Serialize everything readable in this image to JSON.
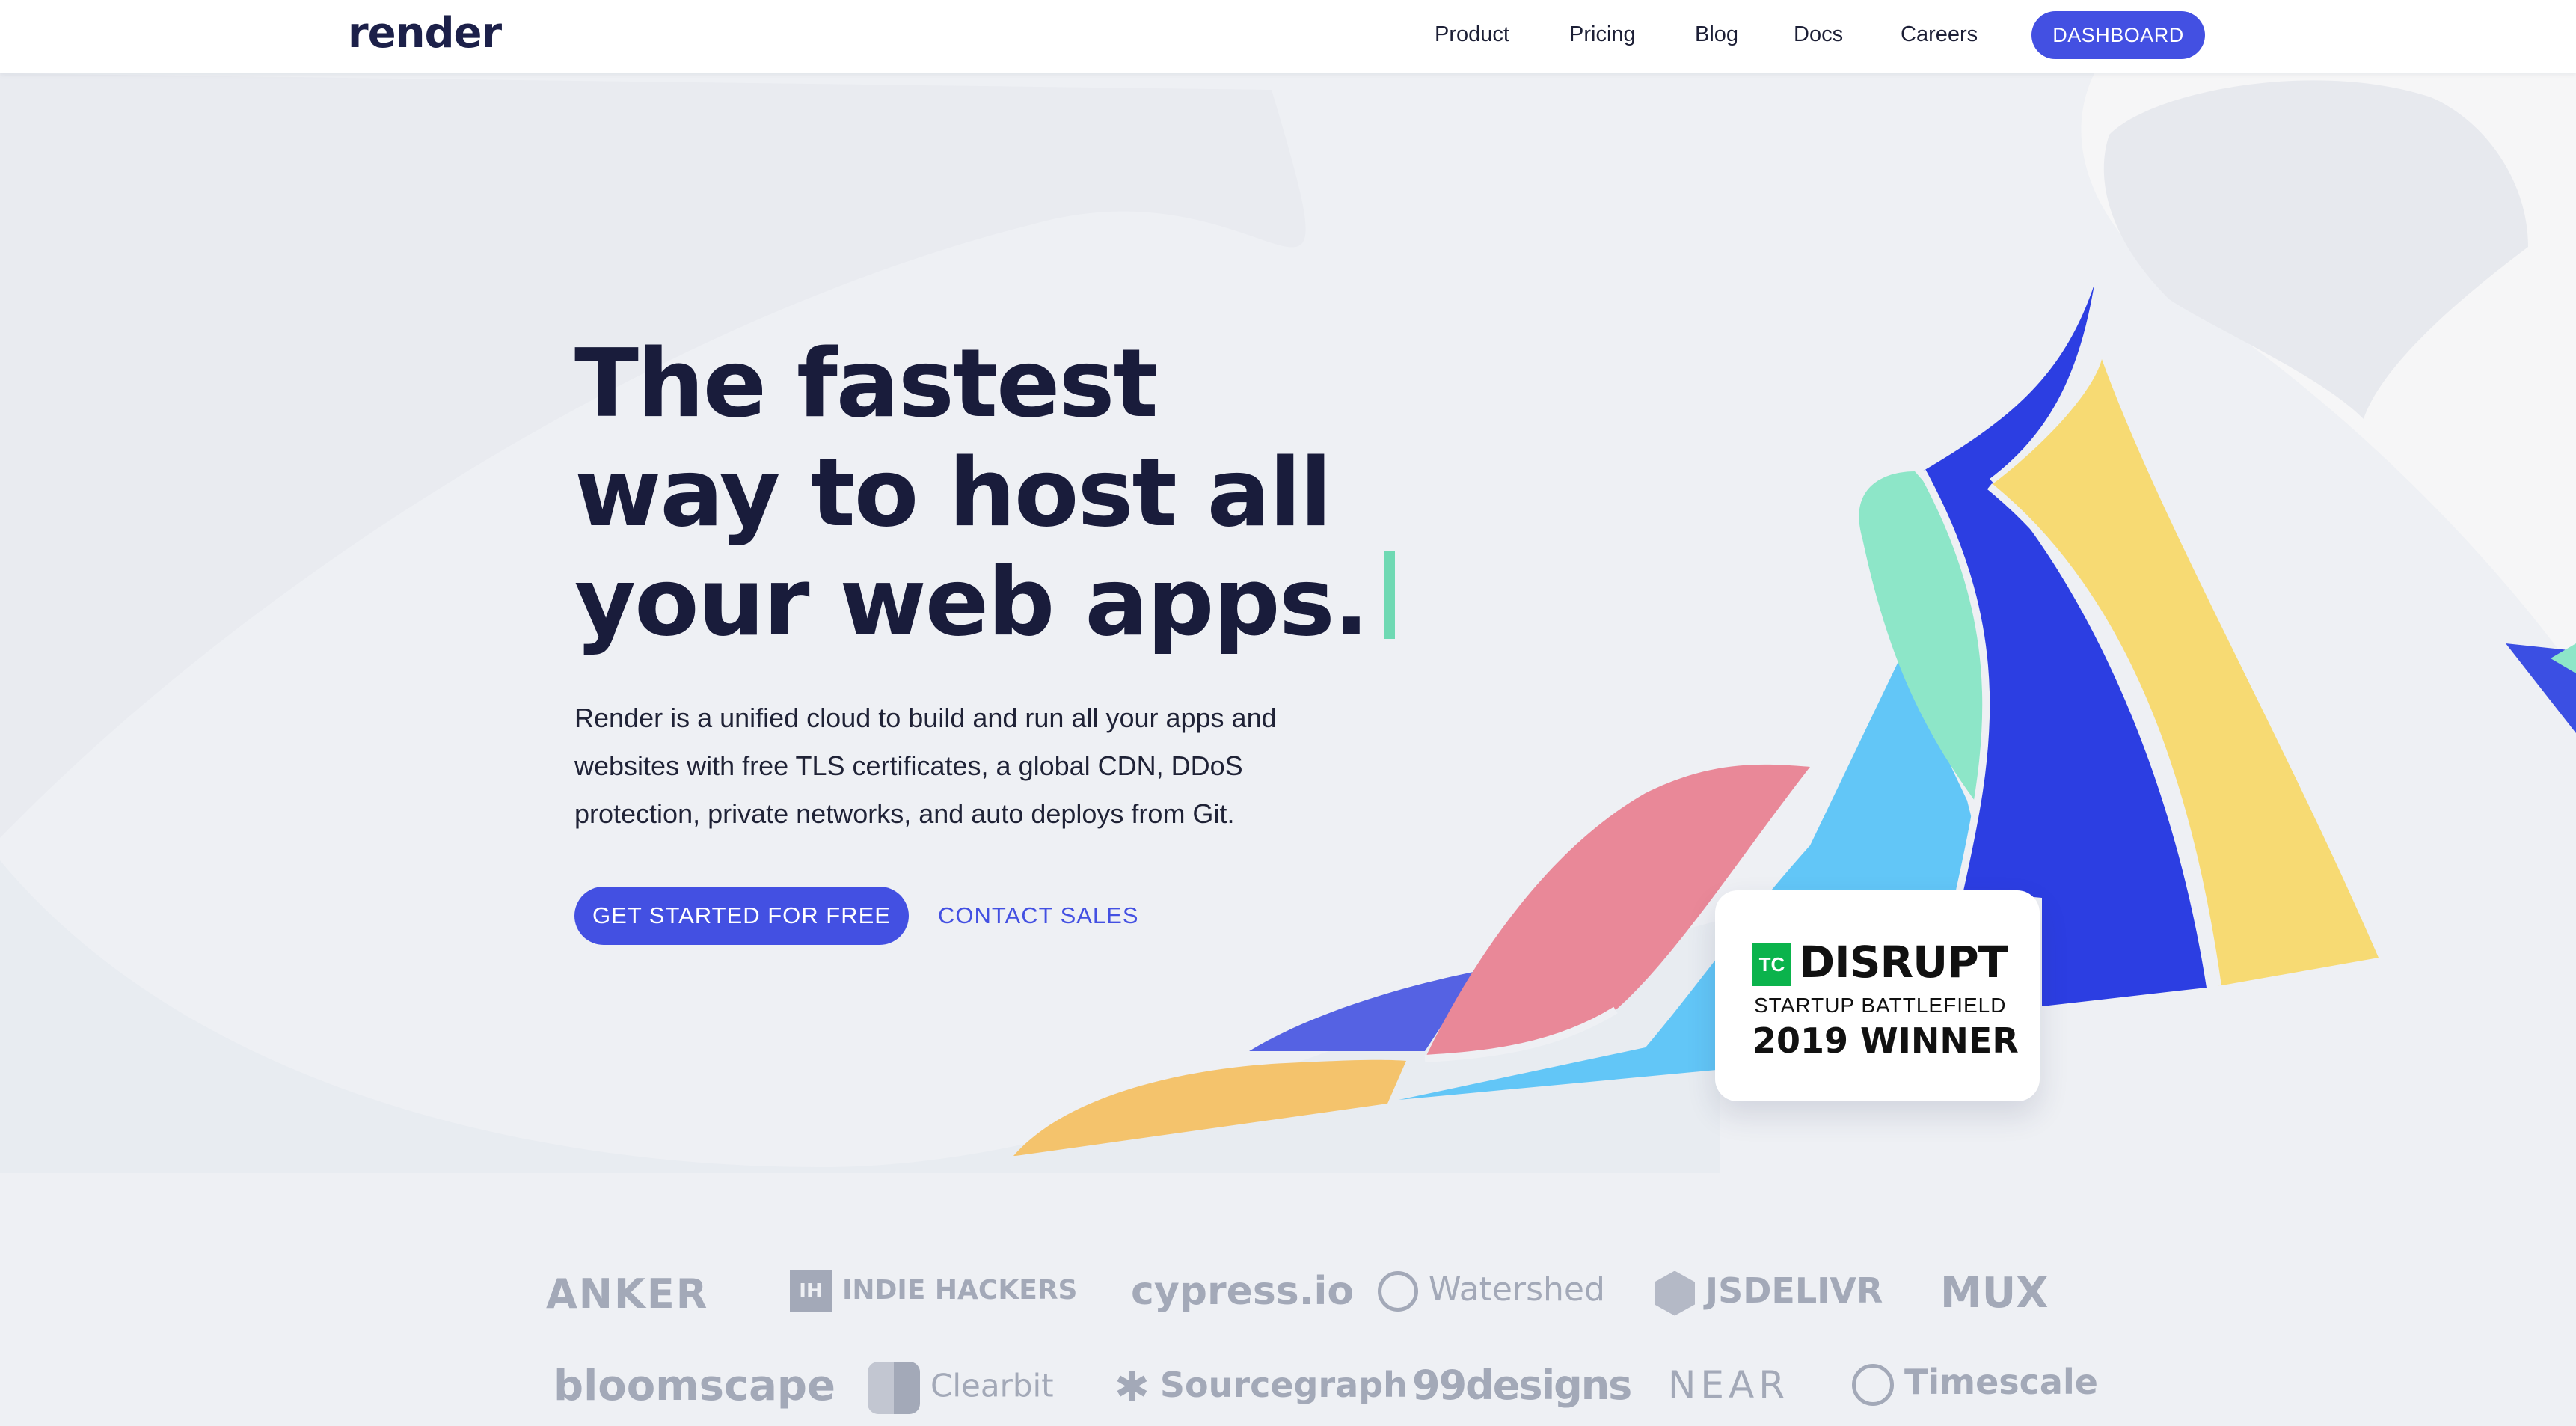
{
  "header": {
    "logo": "render",
    "nav": [
      "Product",
      "Pricing",
      "Blog",
      "Docs",
      "Careers"
    ],
    "dashboard": "DASHBOARD"
  },
  "hero": {
    "headline": [
      "The fastest",
      "way to host all",
      "your web apps."
    ],
    "subtext": "Render is a unified cloud to build and run all your apps and websites with free TLS certificates, a global CDN, DDoS protection, private networks, and auto deploys from Git.",
    "cta_primary": "GET STARTED FOR FREE",
    "cta_secondary": "CONTACT SALES"
  },
  "badge": {
    "logo": "TC",
    "title": "DISRUPT",
    "subtitle": "STARTUP BATTLEFIELD",
    "award": "2019 WINNER"
  },
  "customers": {
    "row1": [
      "ANKER",
      "INDIE HACKERS",
      "cypress.io",
      "Watershed",
      "JSDELIVR",
      "MUX"
    ],
    "row2": [
      "bloomscape",
      "Clearbit",
      "Sourcegraph",
      "99designs",
      "NEAR",
      "Timescale"
    ]
  },
  "colors": {
    "accent": "#4350e2",
    "mint": "#8de6c8",
    "pink": "#e98898",
    "sky": "#62c6f7",
    "yellow": "#f7da73",
    "orange": "#f4c36c",
    "royal": "#2c3ee2",
    "logo_gray": "#a3a9b8"
  }
}
